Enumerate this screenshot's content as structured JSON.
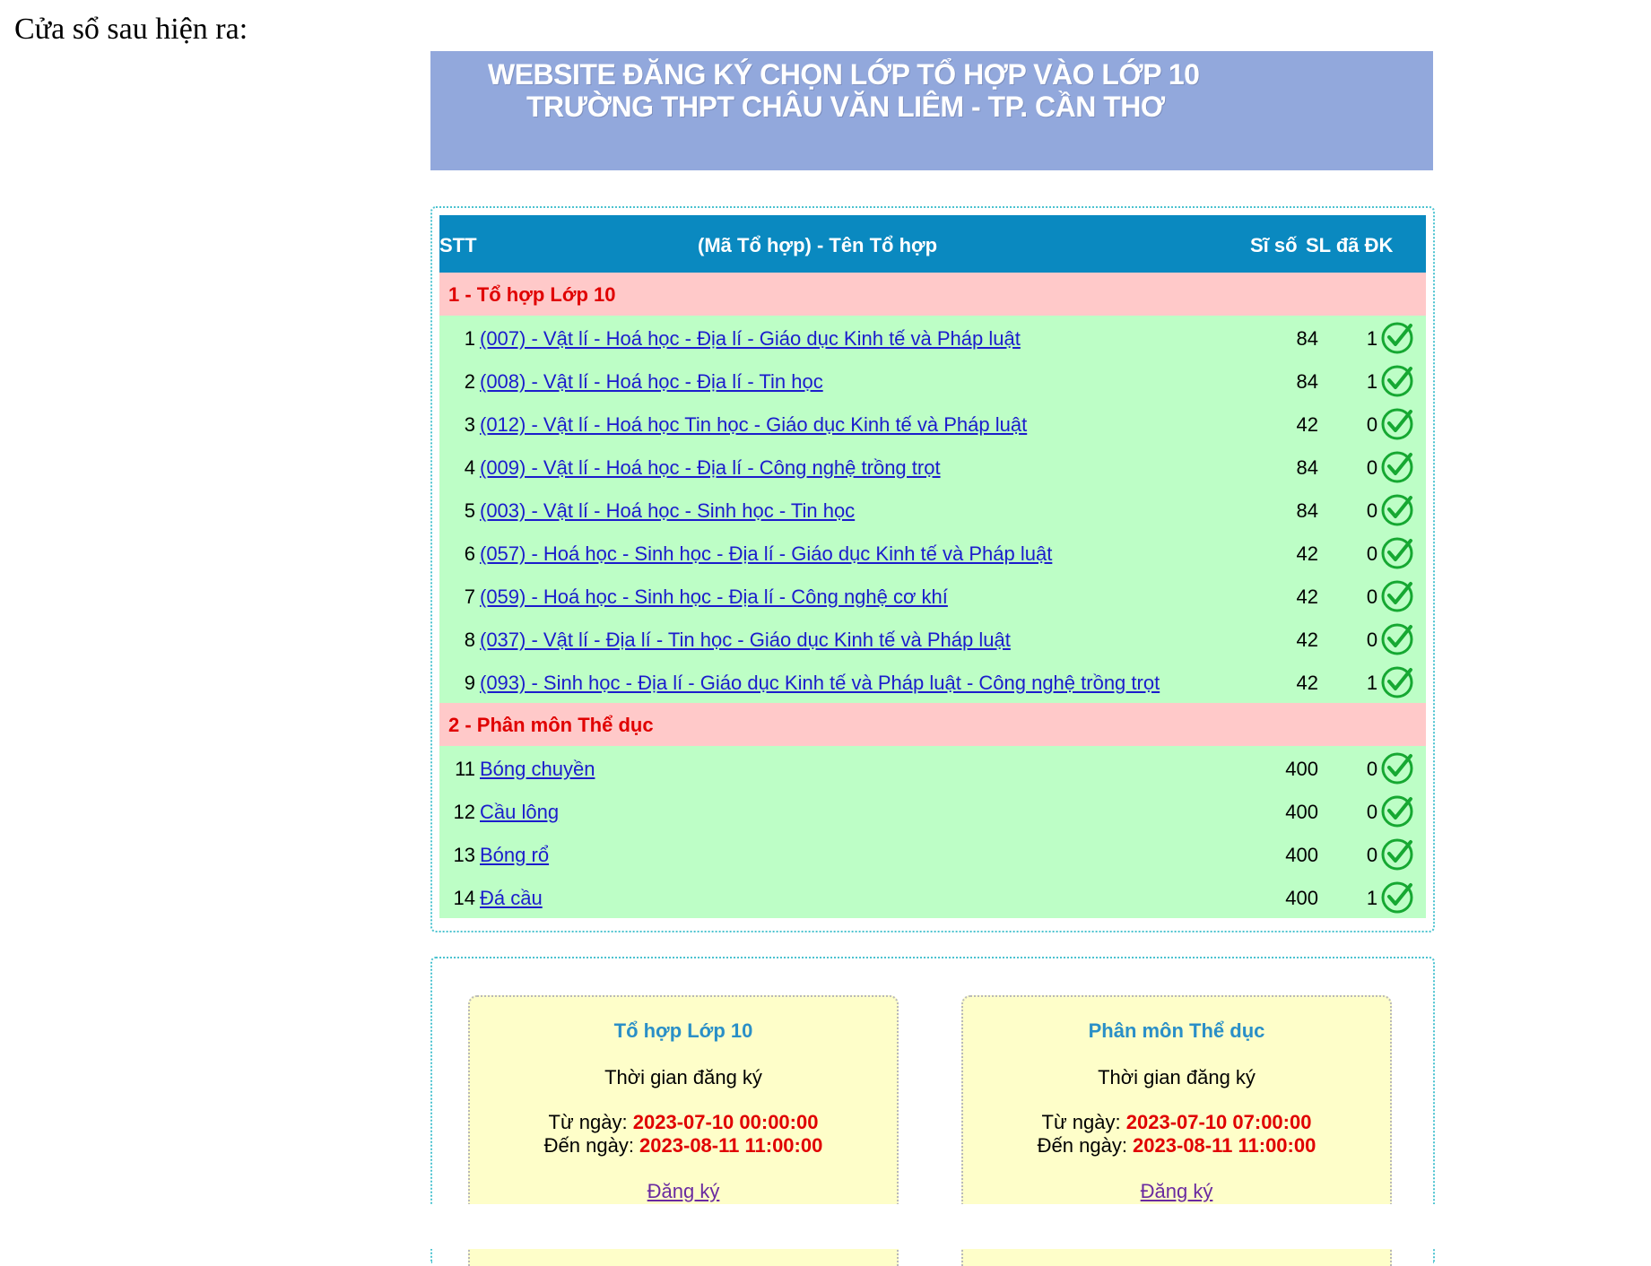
{
  "intro_text": "Cửa sổ sau hiện ra:",
  "banner": {
    "line1": "WEBSITE ĐĂNG KÝ CHỌN LỚP TỔ HỢP VÀO LỚP 10",
    "line2": "TRƯỜNG THPT CHÂU VĂN LIÊM - TP. CẦN THƠ"
  },
  "table": {
    "headers": {
      "stt": "STT",
      "name": "(Mã Tổ hợp) - Tên Tổ hợp",
      "capacity": "Sĩ số",
      "registered": "SL đã ĐK"
    },
    "groups": [
      {
        "title": "1 - Tổ hợp Lớp 10",
        "rows": [
          {
            "stt": "1",
            "name": "(007) - Vật lí - Hoá học - Địa lí - Giáo dục Kinh tế và Pháp luật",
            "capacity": "84",
            "registered": "1"
          },
          {
            "stt": "2",
            "name": "(008) - Vật lí - Hoá học - Địa lí - Tin học",
            "capacity": "84",
            "registered": "1"
          },
          {
            "stt": "3",
            "name": "(012) - Vật lí - Hoá học Tin học - Giáo dục Kinh tế và Pháp luật",
            "capacity": "42",
            "registered": "0"
          },
          {
            "stt": "4",
            "name": "(009) - Vật lí - Hoá học - Địa lí - Công nghệ trồng trọt",
            "capacity": "84",
            "registered": "0"
          },
          {
            "stt": "5",
            "name": "(003) - Vật lí - Hoá học - Sinh học - Tin học",
            "capacity": "84",
            "registered": "0"
          },
          {
            "stt": "6",
            "name": "(057) - Hoá học - Sinh học - Địa lí - Giáo dục Kinh tế và Pháp luật",
            "capacity": "42",
            "registered": "0"
          },
          {
            "stt": "7",
            "name": "(059) - Hoá học - Sinh học - Địa lí - Công nghệ cơ khí",
            "capacity": "42",
            "registered": "0"
          },
          {
            "stt": "8",
            "name": "(037) - Vật lí - Địa lí - Tin học - Giáo dục Kinh tế và Pháp luật",
            "capacity": "42",
            "registered": "0"
          },
          {
            "stt": "9",
            "name": "(093) - Sinh học - Địa lí - Giáo dục Kinh tế và Pháp luật - Công nghệ trồng trọt",
            "capacity": "42",
            "registered": "1"
          }
        ]
      },
      {
        "title": "2 - Phân môn Thể dục",
        "rows": [
          {
            "stt": "11",
            "name": "Bóng chuyền",
            "capacity": "400",
            "registered": "0"
          },
          {
            "stt": "12",
            "name": "Cầu lông",
            "capacity": "400",
            "registered": "0"
          },
          {
            "stt": "13",
            "name": "Bóng rổ",
            "capacity": "400",
            "registered": "0"
          },
          {
            "stt": "14",
            "name": "Đá cầu",
            "capacity": "400",
            "registered": "1"
          }
        ]
      }
    ],
    "status_icon": "check-circle-icon"
  },
  "cards": [
    {
      "title": "Tổ hợp Lớp 10",
      "subtitle": "Thời gian đăng ký",
      "from_label": "Từ ngày: ",
      "from_value": "2023-07-10 00:00:00",
      "to_label": "Đến ngày: ",
      "to_value": "2023-08-11 11:00:00",
      "link": "Đăng ký"
    },
    {
      "title": "Phân môn Thể dục",
      "subtitle": "Thời gian đăng ký",
      "from_label": "Từ ngày: ",
      "from_value": "2023-07-10 07:00:00",
      "to_label": "Đến ngày: ",
      "to_value": "2023-08-11 11:00:00",
      "link": "Đăng ký"
    }
  ],
  "colors": {
    "banner_bg": "#92a8dc",
    "header_bg": "#0a89c0",
    "group_bg": "#ffc9c9",
    "row_bg": "#bdfec6",
    "check_green": "#16a832",
    "date_red": "#e00000",
    "card_bg": "#fefec9"
  }
}
